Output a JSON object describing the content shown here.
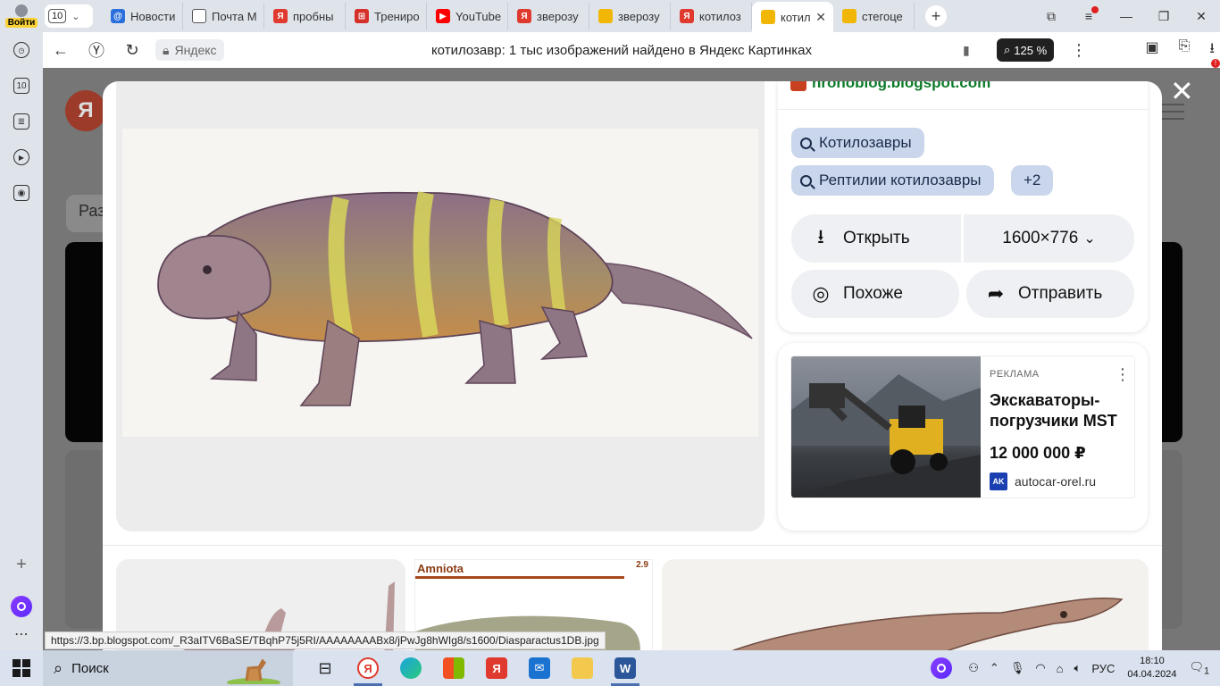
{
  "browser": {
    "user_label": "Войти",
    "tab_count": "10",
    "tabs": [
      {
        "label": "Новости",
        "icon_color": "#2a6fdb",
        "icon_text": "@"
      },
      {
        "label": "Почта M",
        "icon_color": "#ffffff",
        "icon_text": ""
      },
      {
        "label": "пробны",
        "icon_color": "#e03a2e",
        "icon_text": "Я"
      },
      {
        "label": "Трениро",
        "icon_color": "#d6302a",
        "icon_text": "⊞"
      },
      {
        "label": "YouTube",
        "icon_color": "#ff0000",
        "icon_text": "▶"
      },
      {
        "label": "зверозу",
        "icon_color": "#e03a2e",
        "icon_text": "Я"
      },
      {
        "label": "зверозу",
        "icon_color": "#f2b705",
        "icon_text": ""
      },
      {
        "label": "котилоз",
        "icon_color": "#e03a2e",
        "icon_text": "Я"
      },
      {
        "label": "котил",
        "icon_color": "#f2b705",
        "icon_text": "",
        "active": true
      },
      {
        "label": "стегоце",
        "icon_color": "#f2b705",
        "icon_text": ""
      }
    ],
    "site_chip": "Яндекс",
    "page_title": "котилозавр: 1 тыс изображений найдено в Яндекс Картинках",
    "zoom": "125 %",
    "status_url": "https://3.bp.blogspot.com/_R3aITV6BaSE/TBqhP75j5RI/AAAAAAAABx8/jPwJg8hWIg8/s1600/Diasparactus1DB.jpg"
  },
  "page": {
    "logo_letter": "Я",
    "filter_label": "Раз"
  },
  "viewer": {
    "source": "nronoblog.blogspot.com",
    "chips": [
      "Котилозавры",
      "Рептилии котилозавры"
    ],
    "more_chips": "+2",
    "open_label": "Открыть",
    "size_label": "1600×776",
    "similar_label": "Похоже",
    "send_label": "Отправить",
    "ad": {
      "label": "РЕКЛАМА",
      "title": "Экскаваторы-погрузчики MST",
      "price": "12 000 000 ₽",
      "domain": "autocar-orel.ru",
      "domain_logo": "AK"
    },
    "thumbs": {
      "amniota_title": "Amniota",
      "amniota_num": "2.9"
    }
  },
  "taskbar": {
    "search_label": "Поиск",
    "lang": "РУС",
    "time": "18:10",
    "date": "04.04.2024",
    "notifications": "1"
  },
  "colors": {
    "source_green": "#0b7a27",
    "chip_bg": "#c9d6ec",
    "action_bg": "#eef0f3"
  }
}
